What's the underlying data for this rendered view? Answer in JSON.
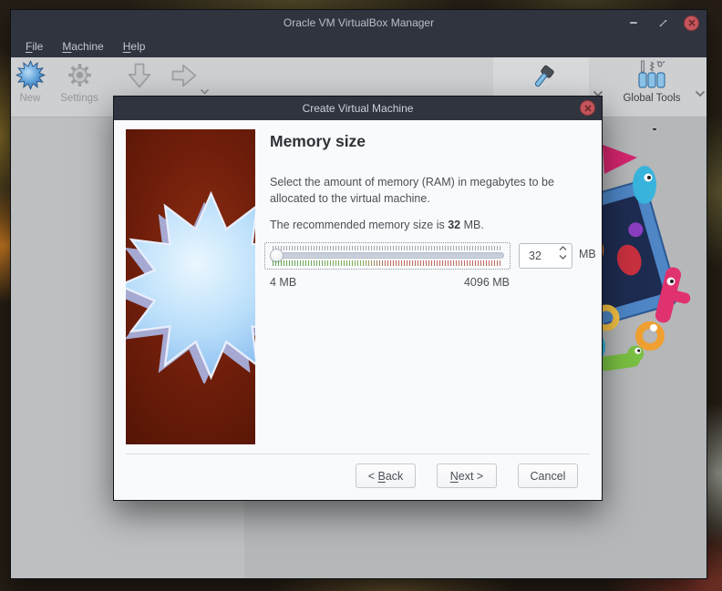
{
  "window": {
    "title": "Oracle VM VirtualBox Manager",
    "menus": [
      {
        "m": "F",
        "rest": "ile"
      },
      {
        "m": "M",
        "rest": "achine"
      },
      {
        "m": "H",
        "rest": "elp"
      }
    ],
    "toolbar": {
      "new": "New",
      "settings": "Settings",
      "global_tools": "Global Tools"
    }
  },
  "dialog": {
    "title": "Create Virtual Machine",
    "heading": "Memory size",
    "description": [
      "Select the amount of memory (RAM) in megabytes to be",
      "allocated to the virtual machine."
    ],
    "recommendation": {
      "pre": "The recommended memory size is ",
      "value": "32",
      "post": " MB."
    },
    "memory": {
      "value": "32",
      "unit": "MB",
      "min_label": "4 MB",
      "max_label": "4096 MB"
    },
    "buttons": {
      "back": {
        "pre": "< ",
        "m": "B",
        "rest": "ack"
      },
      "next": {
        "pre": "",
        "m": "N",
        "rest": "ext >"
      },
      "cancel": "Cancel"
    }
  },
  "icons": {
    "minimize": "minimize-icon",
    "restore": "restore-icon",
    "close": "close-icon",
    "chevron": "chevron-down-icon"
  },
  "colors": {
    "titlebar": "#2f343f",
    "close_red": "#c4555a",
    "toolbar": "#cdcfd1",
    "dialog_bg": "#f9fafb",
    "slider_green": "#61a654",
    "slider_red": "#c26a62"
  }
}
